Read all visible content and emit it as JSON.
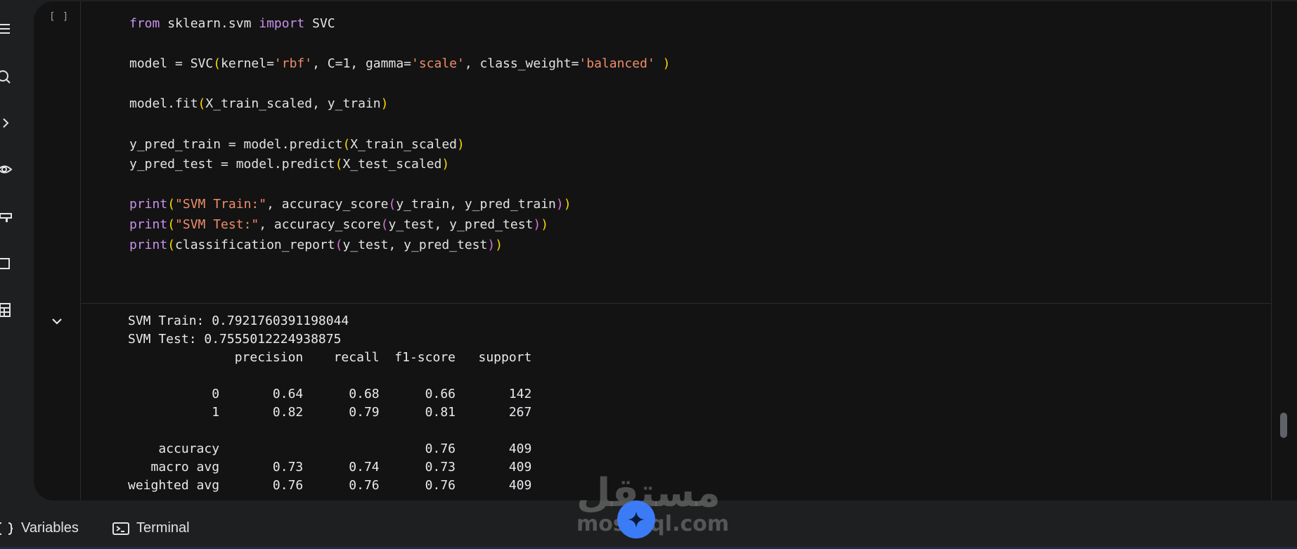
{
  "cell": {
    "run_indicator": "[ ]",
    "code_lines": [
      "from sklearn.svm import SVC",
      "",
      "model = SVC(kernel='rbf', C=1, gamma='scale', class_weight='balanced' )",
      "",
      "model.fit(X_train_scaled, y_train)",
      "",
      "y_pred_train = model.predict(X_train_scaled)",
      "y_pred_test = model.predict(X_test_scaled)",
      "",
      "print(\"SVM Train:\", accuracy_score(y_train, y_pred_train))",
      "print(\"SVM Test:\", accuracy_score(y_test, y_pred_test))",
      "print(classification_report(y_test, y_pred_test))"
    ]
  },
  "output": {
    "lines": [
      "SVM Train: 0.7921760391198044",
      "SVM Test: 0.7555012224938875",
      "              precision    recall  f1-score   support",
      "",
      "           0       0.64      0.68      0.66       142",
      "           1       0.82      0.79      0.81       267",
      "",
      "    accuracy                           0.76       409",
      "   macro avg       0.73      0.74      0.73       409",
      "weighted avg       0.76      0.76      0.76       409"
    ]
  },
  "bottom_bar": {
    "variables_label": "Variables",
    "terminal_label": "Terminal"
  },
  "watermark": {
    "arabic": "مستقل",
    "latin": "mostaql.com"
  },
  "icons": {
    "sidebar": [
      "menu-icon",
      "find-replace-icon",
      "code-snippets-icon",
      "vision-icon",
      "toolbar-icon",
      "window-icon",
      "table-icon"
    ],
    "bottom": [
      "variables-icon",
      "terminal-icon"
    ],
    "fab": "sparkle-icon"
  },
  "colors": {
    "keyword": "#c792ea",
    "string": "#f08d67",
    "bracket_level1": "#ffd700",
    "bracket_level2": "#da70d6",
    "fab": "#3b7cf6"
  }
}
